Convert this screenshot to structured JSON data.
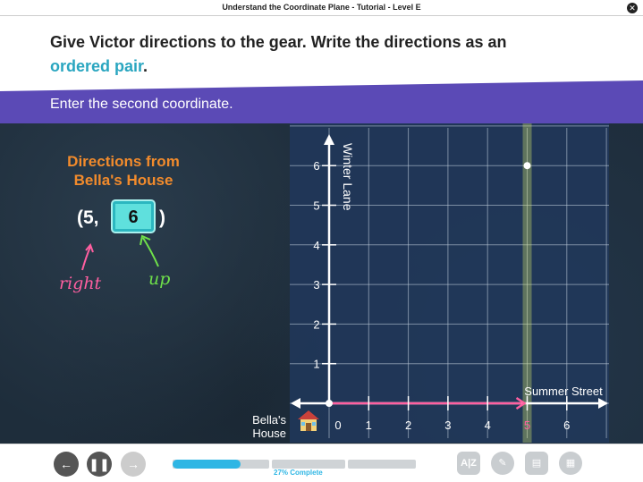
{
  "window": {
    "title": "Understand the Coordinate Plane - Tutorial - Level E",
    "close_icon": "close-icon"
  },
  "prompt": {
    "line1": "Give Victor directions to the gear. Write the directions as an",
    "highlight": "ordered pair",
    "period": "."
  },
  "banner": {
    "instruction": "Enter the second coordinate."
  },
  "directions": {
    "title_line1": "Directions from",
    "title_line2": "Bella's House",
    "open": "(5,",
    "value": "6",
    "close": ")",
    "right_label": "right",
    "up_label": "up"
  },
  "graph": {
    "x_axis_label": "Summer Street",
    "y_axis_label": "Winter Lane",
    "x_ticks": [
      "0",
      "1",
      "2",
      "3",
      "4",
      "5",
      "6"
    ],
    "y_ticks": [
      "1",
      "2",
      "3",
      "4",
      "5",
      "6"
    ],
    "point": {
      "x": 5,
      "y": 6
    },
    "highlight_x": 5,
    "origin_label_line1": "Bella's",
    "origin_label_line2": "House"
  },
  "footer": {
    "progress_text": "27% Complete",
    "progress_percent": 27,
    "back_icon": "back-arrow-icon",
    "pause_icon": "pause-icon",
    "forward_icon": "forward-arrow-icon",
    "tools": [
      "glossary-icon",
      "pencil-icon",
      "notepad-icon",
      "calculator-icon"
    ]
  }
}
